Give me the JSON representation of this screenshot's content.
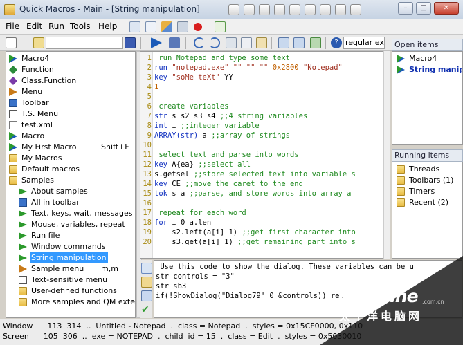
{
  "window": {
    "title": "Quick Macros - Main - [String manipulation]"
  },
  "menu": [
    "File",
    "Edit",
    "Run",
    "Tools",
    "Help"
  ],
  "toolbar": {
    "find_combo_value": "regular exp"
  },
  "tree": [
    {
      "label": "Macro4",
      "icon": "macro-icon"
    },
    {
      "label": "Function",
      "icon": "function-icon"
    },
    {
      "label": "Class.Function",
      "icon": "class-icon"
    },
    {
      "label": "Menu",
      "icon": "menu-icon"
    },
    {
      "label": "Toolbar",
      "icon": "toolbar-icon"
    },
    {
      "label": "T.S. Menu",
      "icon": "ts-menu-icon"
    },
    {
      "label": "test.xml",
      "icon": "file-icon"
    },
    {
      "label": "Macro",
      "icon": "macro-icon"
    },
    {
      "label": "My First Macro",
      "icon": "macro-icon",
      "shortcut": "Shift+F"
    },
    {
      "label": "My Macros",
      "icon": "folder-icon"
    },
    {
      "label": "Default macros",
      "icon": "folder-icon"
    },
    {
      "label": "Samples",
      "icon": "folder-icon"
    },
    {
      "label": "About samples",
      "icon": "arrow-icon"
    },
    {
      "label": "All in toolbar",
      "icon": "toolbar-icon"
    },
    {
      "label": "Text, keys, wait, messages",
      "icon": "arrow-icon"
    },
    {
      "label": "Mouse, variables, repeat",
      "icon": "arrow-icon"
    },
    {
      "label": "Run file",
      "icon": "arrow-icon"
    },
    {
      "label": "Window commands",
      "icon": "arrow-icon"
    },
    {
      "label": "String manipulation",
      "icon": "arrow-icon",
      "selected": true
    },
    {
      "label": "Sample menu",
      "icon": "menu-icon",
      "shortcut": "m,m"
    },
    {
      "label": "Text-sensitive menu",
      "icon": "ts-menu-icon"
    },
    {
      "label": "User-defined functions",
      "icon": "folder-icon"
    },
    {
      "label": "More samples and QM exte",
      "icon": "folder-icon"
    }
  ],
  "code": [
    {
      "n": "1",
      "parts": [
        {
          "t": " run Notepad and type some text",
          "c": "comment"
        }
      ]
    },
    {
      "n": "2",
      "parts": [
        {
          "t": "run ",
          "c": "kw"
        },
        {
          "t": "\"notepad.exe\" \"\" \"\" \"\" ",
          "c": "str"
        },
        {
          "t": "0x2800 ",
          "c": "num"
        },
        {
          "t": "\"Notepad\"",
          "c": "str"
        }
      ]
    },
    {
      "n": "3",
      "parts": [
        {
          "t": "key ",
          "c": "kw"
        },
        {
          "t": "\"soMe teXt\" ",
          "c": "str"
        },
        {
          "t": "YY",
          "c": ""
        }
      ]
    },
    {
      "n": "4",
      "parts": [
        {
          "t": "1",
          "c": "num"
        }
      ]
    },
    {
      "n": "5",
      "parts": []
    },
    {
      "n": "6",
      "parts": [
        {
          "t": " create variables",
          "c": "comment"
        }
      ]
    },
    {
      "n": "7",
      "parts": [
        {
          "t": "str ",
          "c": "kw"
        },
        {
          "t": "s s2 s3 s4 ",
          "c": ""
        },
        {
          "t": ";;4 string variables",
          "c": "comment"
        }
      ]
    },
    {
      "n": "8",
      "parts": [
        {
          "t": "int ",
          "c": "kw"
        },
        {
          "t": "i ",
          "c": ""
        },
        {
          "t": ";;integer variable",
          "c": "comment"
        }
      ]
    },
    {
      "n": "9",
      "parts": [
        {
          "t": "ARRAY(str) ",
          "c": "kw"
        },
        {
          "t": "a ",
          "c": ""
        },
        {
          "t": ";;array of strings",
          "c": "comment"
        }
      ]
    },
    {
      "n": "10",
      "parts": []
    },
    {
      "n": "11",
      "parts": [
        {
          "t": " select text and parse into words",
          "c": "comment"
        }
      ]
    },
    {
      "n": "12",
      "parts": [
        {
          "t": "key ",
          "c": "kw"
        },
        {
          "t": "A{ea} ",
          "c": ""
        },
        {
          "t": ";;select all",
          "c": "comment"
        }
      ]
    },
    {
      "n": "13",
      "parts": [
        {
          "t": "s.getsel ",
          "c": ""
        },
        {
          "t": ";;store selected text into variable s",
          "c": "comment"
        }
      ]
    },
    {
      "n": "14",
      "parts": [
        {
          "t": "key ",
          "c": "kw"
        },
        {
          "t": "CE ",
          "c": ""
        },
        {
          "t": ";;move the caret to the end",
          "c": "comment"
        }
      ]
    },
    {
      "n": "15",
      "parts": [
        {
          "t": "tok ",
          "c": "kw"
        },
        {
          "t": "s a ",
          "c": ""
        },
        {
          "t": ";;parse, and store words into array a",
          "c": "comment"
        }
      ]
    },
    {
      "n": "16",
      "parts": []
    },
    {
      "n": "17",
      "parts": [
        {
          "t": " repeat for each word",
          "c": "comment"
        }
      ]
    },
    {
      "n": "18",
      "parts": [
        {
          "t": "for ",
          "c": "kw"
        },
        {
          "t": "i 0 a.len",
          "c": ""
        }
      ]
    },
    {
      "n": "19",
      "parts": [
        {
          "t": "    s2.left(a[i] 1) ",
          "c": ""
        },
        {
          "t": ";;get first character into",
          "c": "comment"
        }
      ]
    },
    {
      "n": "20",
      "parts": [
        {
          "t": "    s3.get(a[i] 1) ",
          "c": ""
        },
        {
          "t": ";;get remaining part into s",
          "c": "comment"
        }
      ]
    }
  ],
  "output": [
    " Use this code to show the dialog. These variables can be u",
    "str controls = \"3\"",
    "str sb3",
    "if(!ShowDialog(\"Dialog79\" 0 &controls)) ret"
  ],
  "open_items": {
    "title": "Open items",
    "items": [
      {
        "label": "Macro4",
        "bold": false
      },
      {
        "label": "String manip",
        "bold": true
      }
    ]
  },
  "running_items": {
    "title": "Running items",
    "items": [
      "Threads",
      "Toolbars (1)",
      "Timers",
      "Recent (2)"
    ]
  },
  "status": [
    "Window      113  314  ..  Untitled - Notepad  .  class = Notepad  .  styles = 0x15CF0000, 0x110",
    "Screen      105  306  ..  exe = NOTEPAD  .  child  id = 15  .  class = Edit  .  styles = 0x5030010"
  ],
  "watermark": {
    "brand": "PConline",
    "domain": ".com.cn",
    "cn": "太平洋电脑网"
  }
}
